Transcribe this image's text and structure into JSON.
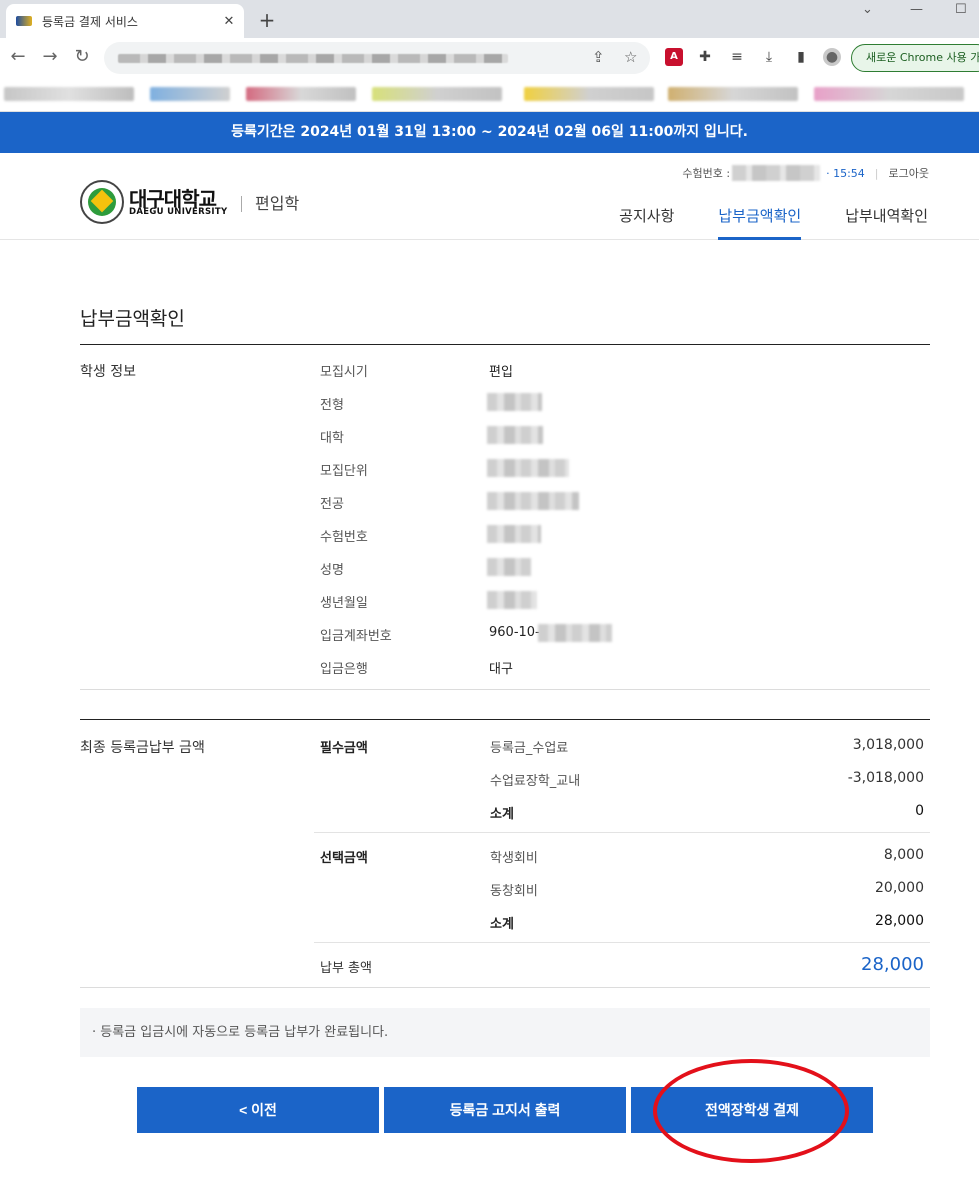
{
  "browser": {
    "tab_title": "등록금 결제 서비스",
    "tab_close": "✕",
    "new_tab": "+",
    "chrome_button": "새로운 Chrome 사용 가"
  },
  "banner": {
    "text": "등록기간은 2024년 01월 31일 13:00 ~ 2024년 02월 06일 11:00까지 입니다."
  },
  "header": {
    "logo_kr": "대구대학교",
    "logo_en": "DAEGU UNIVERSITY",
    "logo_sub": "편입학",
    "exam_label": "수험번호 :",
    "timer": "· 15:54",
    "logout": "로그아웃",
    "nav": [
      "공지사항",
      "납부금액확인",
      "납부내역확인"
    ]
  },
  "page": {
    "title": "납부금액확인"
  },
  "student_info": {
    "section_title": "학생 정보",
    "rows": [
      {
        "label": "모집시기",
        "value": "편입"
      },
      {
        "label": "전형",
        "value": ""
      },
      {
        "label": "대학",
        "value": ""
      },
      {
        "label": "모집단위",
        "value": ""
      },
      {
        "label": "전공",
        "value": ""
      },
      {
        "label": "수험번호",
        "value": ""
      },
      {
        "label": "성명",
        "value": ""
      },
      {
        "label": "생년월일",
        "value": ""
      },
      {
        "label": "입금계좌번호",
        "value": "960-10-"
      },
      {
        "label": "입금은행",
        "value": "대구"
      }
    ]
  },
  "fees": {
    "section_title": "최종 등록금납부 금액",
    "required": {
      "label": "필수금액",
      "items": [
        {
          "name": "등록금_수업료",
          "amount": "3,018,000"
        },
        {
          "name": "수업료장학_교내",
          "amount": "-3,018,000"
        }
      ],
      "subtotal_label": "소계",
      "subtotal": "0"
    },
    "optional": {
      "label": "선택금액",
      "items": [
        {
          "name": "학생회비",
          "amount": "8,000"
        },
        {
          "name": "동창회비",
          "amount": "20,000"
        }
      ],
      "subtotal_label": "소계",
      "subtotal": "28,000"
    },
    "total_label": "납부 총액",
    "total": "28,000"
  },
  "notice": "· 등록금 입금시에 자동으로 등록금 납부가 완료됩니다.",
  "buttons": {
    "prev": "< 이전",
    "print": "등록금 고지서 출력",
    "pay": "전액장학생 결제"
  },
  "colors": {
    "primary": "#1b64c8",
    "annotation": "#e3101a"
  }
}
